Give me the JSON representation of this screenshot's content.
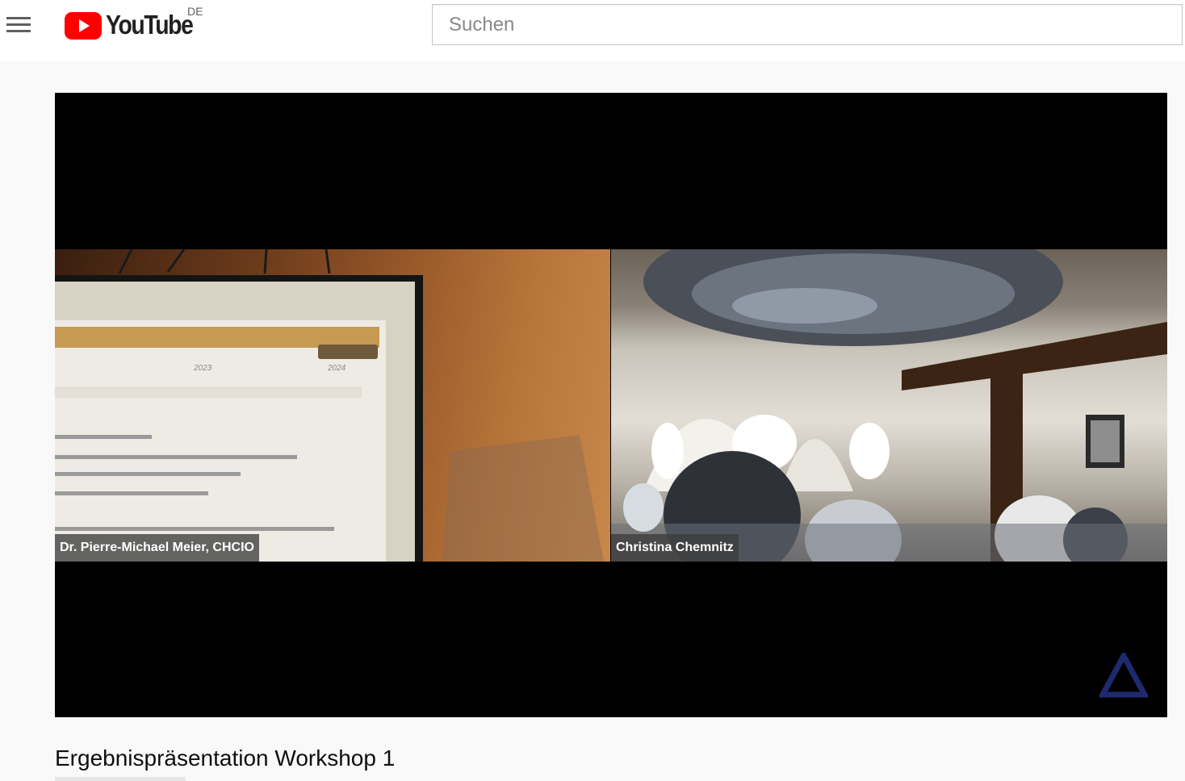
{
  "masthead": {
    "menu_icon": "hamburger-menu-icon",
    "logo_icon": "youtube-play-icon",
    "logo_text": "YouTube",
    "country_code": "DE",
    "brand_color": "#ff0000",
    "search": {
      "placeholder": "Suchen",
      "value": ""
    }
  },
  "player": {
    "participants": [
      {
        "name": "Dr. Pierre-Michael Meier, CHCIO"
      },
      {
        "name": "Christina Chemnitz"
      }
    ],
    "watermark_icon": "triangle-logo-icon",
    "slide_years": [
      "2023",
      "2024"
    ]
  },
  "video": {
    "title": "Ergebnispräsentation Workshop 1"
  }
}
